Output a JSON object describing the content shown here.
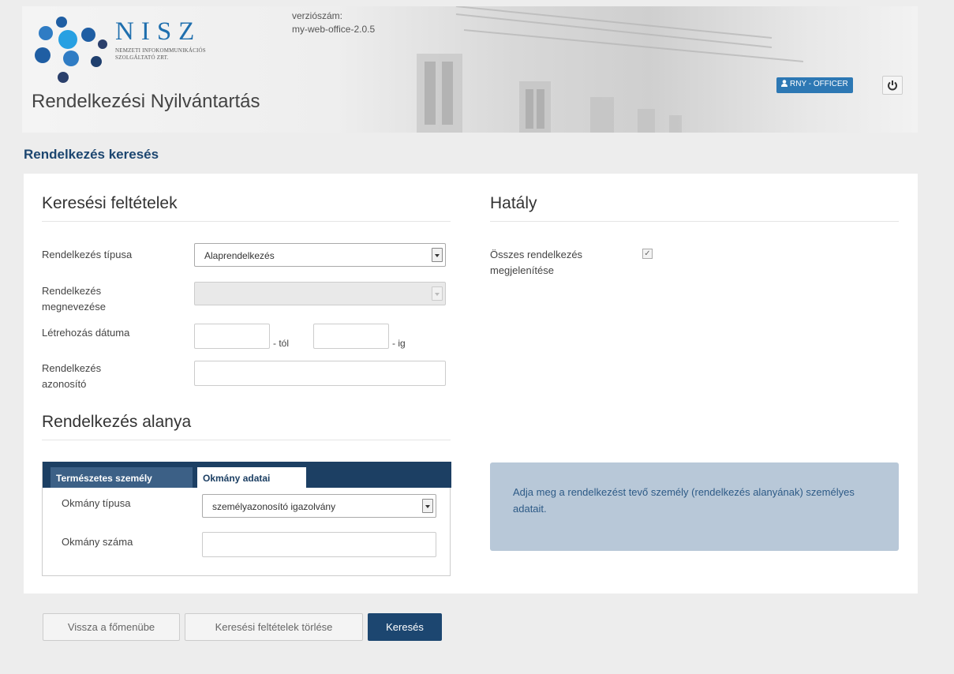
{
  "header": {
    "logo": {
      "word": "NISZ",
      "subtitle_line1": "NEMZETI INFOKOMMUNIKÁCIÓS",
      "subtitle_line2": "SZOLGÁLTATÓ ZRT."
    },
    "app_title": "Rendelkezési Nyilvántartás",
    "version_label": "verziószám:",
    "version_value": "my-web-office-2.0.5",
    "user_button": "RNY - OFFICER",
    "user_icon": "user-icon",
    "power_icon": "power-icon"
  },
  "page_title": "Rendelkezés keresés",
  "search": {
    "heading": "Keresési feltételek",
    "type_label": "Rendelkezés típusa",
    "type_value": "Alaprendelkezés",
    "name_label_l1": "Rendelkezés",
    "name_label_l2": "megnevezése",
    "name_value": "",
    "date_label": "Létrehozás dátuma",
    "date_from_suffix": "- tól",
    "date_to_suffix": "- ig",
    "date_from_value": "",
    "date_to_value": "",
    "id_label_l1": "Rendelkezés",
    "id_label_l2": "azonosító",
    "id_value": ""
  },
  "scope": {
    "heading": "Hatály",
    "all_label_l1": "Összes rendelkezés",
    "all_label_l2": "megjelenítése",
    "all_checked": true
  },
  "subject": {
    "heading": "Rendelkezés alanya",
    "tabs": [
      {
        "label": "Természetes személy",
        "active": false
      },
      {
        "label": "Okmány adatai",
        "active": true
      }
    ],
    "doc_type_label": "Okmány típusa",
    "doc_type_value": "személyazonosító igazolvány",
    "doc_number_label": "Okmány száma",
    "doc_number_value": ""
  },
  "info_text": "Adja meg a rendelkezést tevő személy (rendelkezés alanyának) személyes adatait.",
  "buttons": {
    "back": "Vissza a főmenübe",
    "clear": "Keresési feltételek törlése",
    "search": "Keresés"
  },
  "colors": {
    "primary": "#1c4670",
    "tabbar": "#1c3f63",
    "user_button": "#2d78b4",
    "info_bg": "#b8c8d8"
  }
}
